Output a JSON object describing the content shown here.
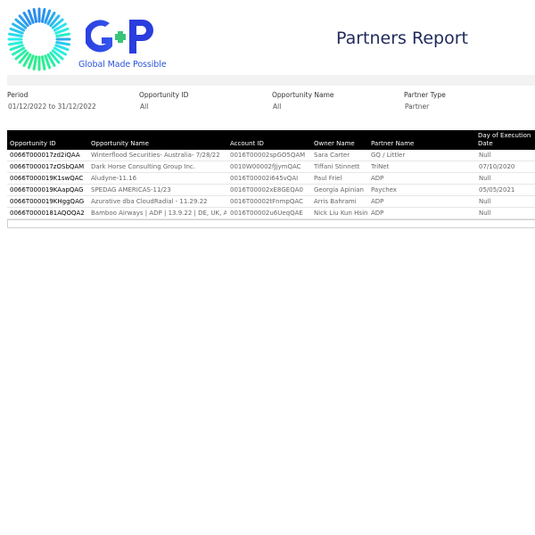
{
  "logo": {
    "tagline": "Global Made Possible"
  },
  "report": {
    "title": "Partners Report"
  },
  "filters": [
    {
      "label": "Period",
      "value": "01/12/2022 to 31/12/2022"
    },
    {
      "label": "Opportunity ID",
      "value": "All"
    },
    {
      "label": "Opportunity Name",
      "value": "All"
    },
    {
      "label": "Partner Type",
      "value": "Partner"
    }
  ],
  "table": {
    "columns": [
      "Opportunity ID",
      "Opportunity Name",
      "Account ID",
      "Owner Name",
      "Partner Name",
      "Day of Execution Date"
    ],
    "rows": [
      [
        "0066T000017zd2iQAA",
        "Winterflood Securities- Australia- 7/28/22",
        "0016T00002spGO5QAM",
        "Sara Carter",
        "GQ / Littler",
        "Null"
      ],
      [
        "0066T000017zOSbQAM",
        "Dark Horse Consulting Group Inc.",
        "0010W00002fJjymQAC",
        "Tiffani Stinnett",
        "TriNet",
        "07/10/2020"
      ],
      [
        "0066T000019K1swQAC",
        "Aludyne-11.16",
        "0016T00002i645vQAI",
        "Paul Friel",
        "ADP",
        "Null"
      ],
      [
        "0066T000019KAapQAG",
        "SPEDAG AMERICAS-11/23",
        "0016T00002xE8GEQA0",
        "Georgia Apinian",
        "Paychex",
        "05/05/2021"
      ],
      [
        "0066T000019KHggQAG",
        "Azurative dba CloudRadial - 11.29.22",
        "0016T00002tFnmpQAC",
        "Arris Bahrami",
        "ADP",
        "Null"
      ],
      [
        "0066T0000181AQOQA2",
        "Bamboo Airways | ADP | 13.9.22 | DE, UK, A..",
        "0016T00002u6UeqQAE",
        "Nick Liu Kun Hsin",
        "ADP",
        "Null"
      ]
    ]
  }
}
